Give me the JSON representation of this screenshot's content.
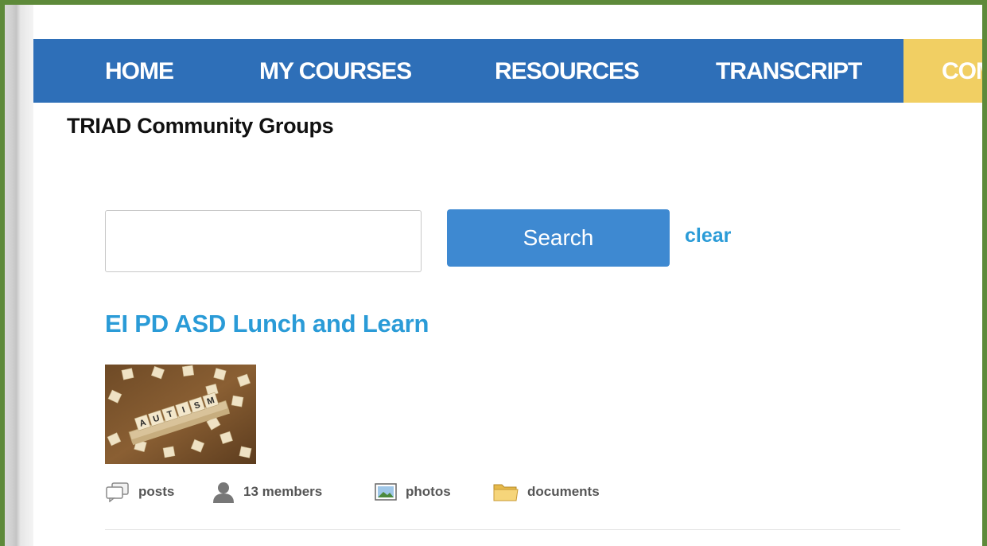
{
  "nav": {
    "items": [
      {
        "label": "HOME"
      },
      {
        "label": "MY COURSES"
      },
      {
        "label": "RESOURCES"
      },
      {
        "label": "TRANSCRIPT"
      },
      {
        "label": "COMMUNITY"
      }
    ],
    "active_color": "#f1cf63",
    "bar_color": "#2e6fb8"
  },
  "page": {
    "title": "TRIAD Community Groups"
  },
  "search": {
    "value": "",
    "placeholder": "",
    "button_label": "Search",
    "clear_label": "clear"
  },
  "group": {
    "title": "EI PD ASD Lunch and Learn",
    "thumbnail_tiles": [
      "A",
      "U",
      "T",
      "I",
      "S",
      "M"
    ],
    "stats": {
      "posts_label": "posts",
      "members_label": "13 members",
      "photos_label": "photos",
      "documents_label": "documents"
    }
  },
  "colors": {
    "link": "#2a9bd7",
    "button": "#3e89d1",
    "frame": "#5e8a3a"
  },
  "icons": [
    "posts-icon",
    "members-icon",
    "photos-icon",
    "documents-icon"
  ]
}
